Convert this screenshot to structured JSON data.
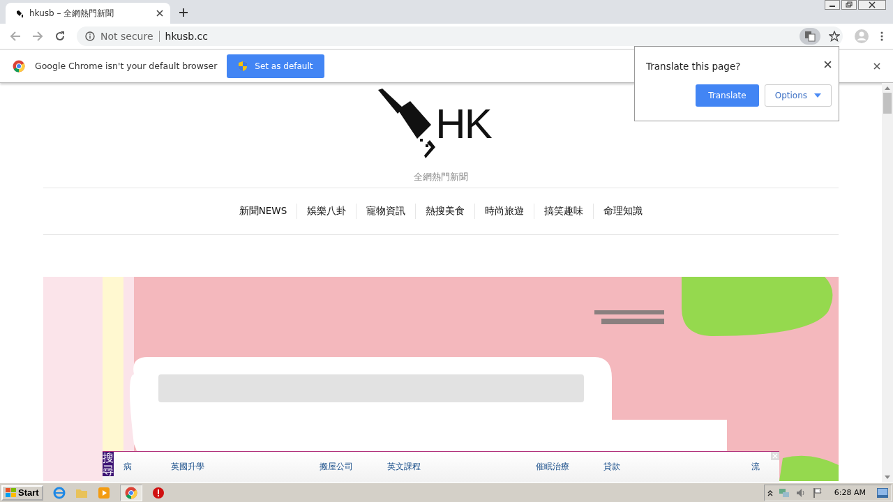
{
  "browser": {
    "tab": {
      "title": "hkusb – 全網熱門新聞",
      "selected": true
    },
    "security": "Not secure",
    "url": "hkusb.cc"
  },
  "infobar": {
    "message": "Google Chrome isn't your default browser",
    "button": "Set as default"
  },
  "translate_popup": {
    "title": "Translate this page?",
    "translate_button": "Translate",
    "options_button": "Options"
  },
  "site": {
    "logo_text": "HK",
    "tagline": "全網熱門新聞",
    "nav": [
      {
        "label": "新聞NEWS"
      },
      {
        "label": "娛樂八卦"
      },
      {
        "label": "寵物資訊"
      },
      {
        "label": "熱搜美食"
      },
      {
        "label": "時尚旅遊"
      },
      {
        "label": "搞笑趣味"
      },
      {
        "label": "命理知識"
      }
    ]
  },
  "ad_bar": {
    "label": "搜尋",
    "links": [
      {
        "label": "病"
      },
      {
        "label": "英國升學"
      },
      {
        "label": "搬屋公司"
      },
      {
        "label": "英文課程"
      },
      {
        "label": "催眠治療"
      },
      {
        "label": "貸款"
      },
      {
        "label": "流"
      }
    ]
  },
  "taskbar": {
    "start": "Start",
    "clock": "6:28 AM"
  }
}
